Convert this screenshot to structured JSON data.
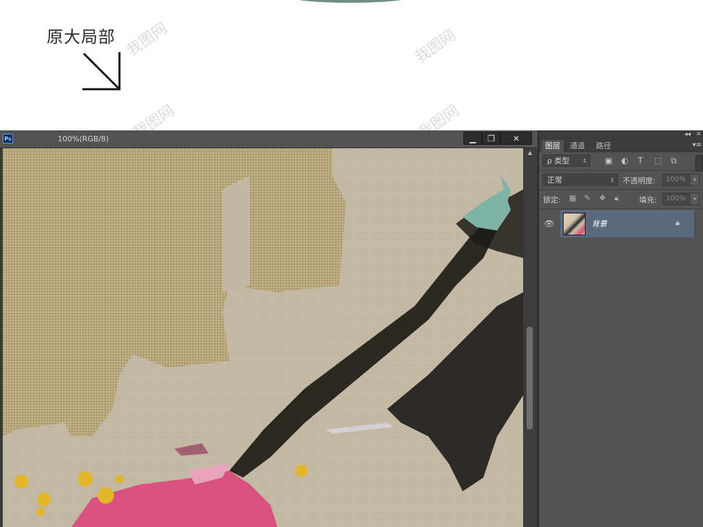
{
  "banner": {
    "label": "原大局部",
    "watermark": "我图网"
  },
  "document": {
    "title": "100%(RGB/8)",
    "app_badge": "Ps",
    "buttons": {
      "minimize": "▁",
      "maximize": "❐",
      "close": "✕"
    }
  },
  "panel": {
    "top_icons": {
      "collapse": "◂◂",
      "close": "✕"
    },
    "tabs": [
      {
        "label": "图层",
        "active": true
      },
      {
        "label": "通道",
        "active": false
      },
      {
        "label": "路径",
        "active": false
      }
    ],
    "tab_menu": "▾≡",
    "filter": {
      "label": "ρ 类型",
      "arrow": "⇕"
    },
    "blend_mode": {
      "value": "正常",
      "arrow": "⇕"
    },
    "opacity": {
      "label": "不透明度:",
      "value": "100%",
      "arrow": "▾"
    },
    "lock": {
      "label": "锁定:"
    },
    "fill": {
      "label": "填充:",
      "value": "100%",
      "arrow": "▾"
    },
    "layers": [
      {
        "name": "背景",
        "visible": true,
        "locked": true
      }
    ]
  },
  "colors": {
    "canvas_linen": "#b3a27a",
    "canvas_gesso": "#c2b8a3",
    "ink": "#1e1c18",
    "pink": "#d9517e",
    "yellow": "#e3b62a",
    "teal": "#7fb3a8",
    "selected_layer": "#5a6b80"
  }
}
